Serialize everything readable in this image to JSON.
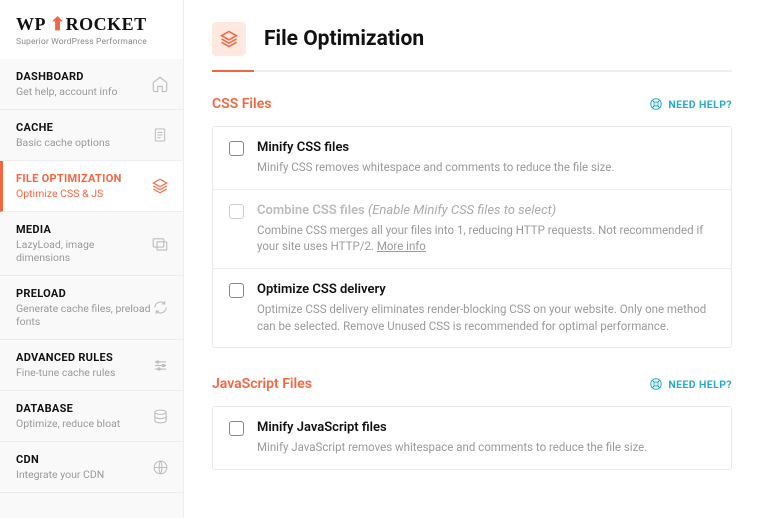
{
  "logo": {
    "wp": "WP",
    "rocket": "ROCKET",
    "tagline": "Superior WordPress Performance"
  },
  "nav": [
    {
      "title": "DASHBOARD",
      "sub": "Get help, account info",
      "icon": "home"
    },
    {
      "title": "CACHE",
      "sub": "Basic cache options",
      "icon": "doc"
    },
    {
      "title": "FILE OPTIMIZATION",
      "sub": "Optimize CSS & JS",
      "icon": "layers",
      "active": true
    },
    {
      "title": "MEDIA",
      "sub": "LazyLoad, image dimensions",
      "icon": "media"
    },
    {
      "title": "PRELOAD",
      "sub": "Generate cache files, preload fonts",
      "icon": "refresh"
    },
    {
      "title": "ADVANCED RULES",
      "sub": "Fine-tune cache rules",
      "icon": "sliders"
    },
    {
      "title": "DATABASE",
      "sub": "Optimize, reduce bloat",
      "icon": "db"
    },
    {
      "title": "CDN",
      "sub": "Integrate your CDN",
      "icon": "globe"
    }
  ],
  "header": {
    "title": "File Optimization"
  },
  "help_label": "NEED HELP?",
  "sections": {
    "css": {
      "title": "CSS Files",
      "options": [
        {
          "title": "Minify CSS files",
          "desc": "Minify CSS removes whitespace and comments to reduce the file size."
        },
        {
          "title": "Combine CSS files",
          "hint": " (Enable Minify CSS files to select)",
          "desc": "Combine CSS merges all your files into 1, reducing HTTP requests. Not recommended if your site uses HTTP/2. ",
          "link": "More info",
          "disabled": true
        },
        {
          "title": "Optimize CSS delivery",
          "desc": "Optimize CSS delivery eliminates render-blocking CSS on your website. Only one method can be selected. Remove Unused CSS is recommended for optimal performance."
        }
      ]
    },
    "js": {
      "title": "JavaScript Files",
      "options": [
        {
          "title": "Minify JavaScript files",
          "desc": "Minify JavaScript removes whitespace and comments to reduce the file size."
        }
      ]
    }
  }
}
